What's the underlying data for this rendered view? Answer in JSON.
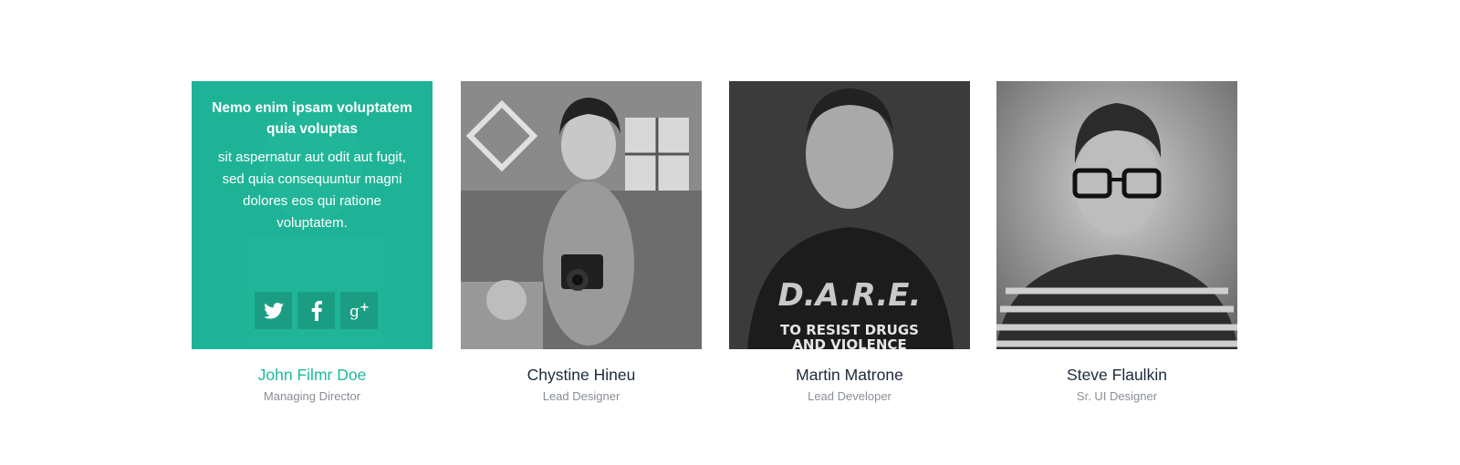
{
  "colors": {
    "accent": "#1abc9c",
    "name_text": "#1d2a3a",
    "role_text": "#8a8f95"
  },
  "members": [
    {
      "name": "John Filmr Doe",
      "role": "Managing Director",
      "overlay": {
        "heading": "Nemo enim ipsam voluptatem quia voluptas",
        "text": "sit aspernatur aut odit aut fugit, sed quia consequuntur magni dolores eos qui ratione voluptatem."
      },
      "socials": [
        "twitter-icon",
        "facebook-icon",
        "google-plus-icon"
      ]
    },
    {
      "name": "Chystine Hineu",
      "role": "Lead Designer"
    },
    {
      "name": "Martin Matrone",
      "role": "Lead Developer",
      "shirt_text": [
        "D.A.R.E.",
        "TO RESIST DRUGS",
        "AND VIOLENCE"
      ]
    },
    {
      "name": "Steve Flaulkin",
      "role": "Sr. UI Designer"
    }
  ]
}
